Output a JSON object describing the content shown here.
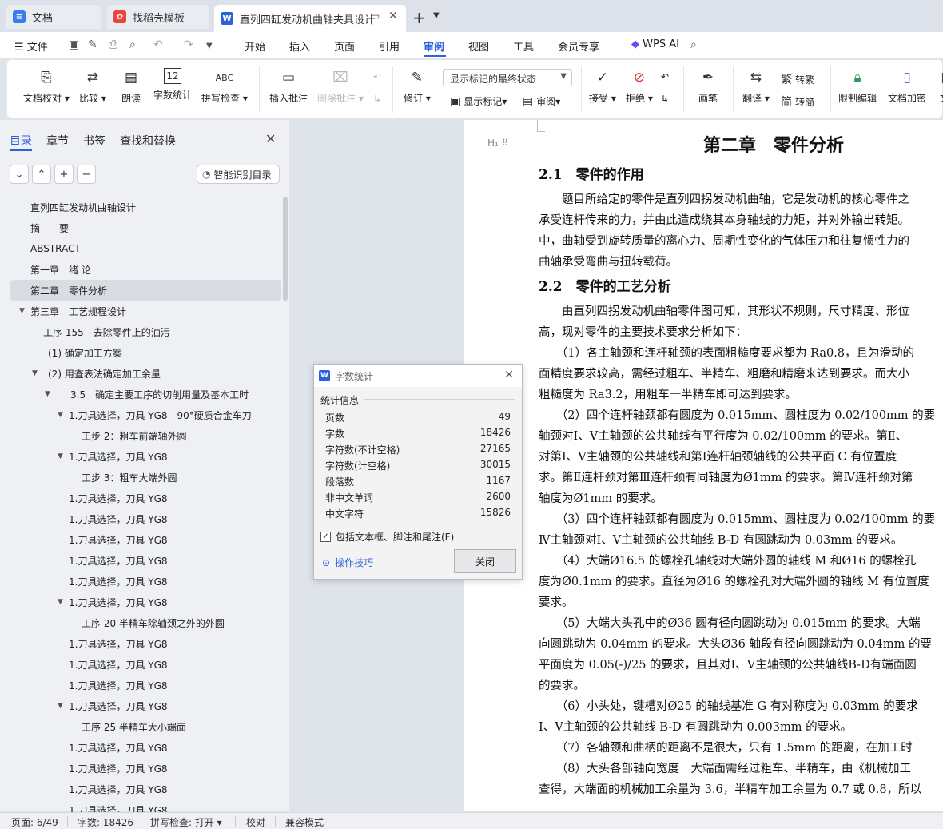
{
  "tabs": [
    {
      "icon": "document-app-icon",
      "label": "文档"
    },
    {
      "icon": "template-app-icon",
      "label": "找稻壳模板"
    },
    {
      "icon": "word-app-icon",
      "label": "直列四缸发动机曲轴夹具设计"
    }
  ],
  "menu": {
    "file": "文件",
    "items": [
      "开始",
      "插入",
      "页面",
      "引用",
      "审阅",
      "视图",
      "工具",
      "会员专享"
    ],
    "active": "审阅",
    "wps_ai": "WPS AI"
  },
  "ribbon": {
    "proofread": "文档校对",
    "compare": "比较",
    "read_aloud": "朗读",
    "word_count": "字数统计",
    "word_count_icon_text": "12",
    "spell_check": "拼写检查",
    "spell_icon_text": "ABC",
    "insert_comment": "插入批注",
    "delete_comment": "删除批注",
    "revise": "修订",
    "markup_display": "显示标记的最终状态",
    "show_markup": "显示标记",
    "review": "审阅",
    "accept": "接受",
    "reject": "拒绝",
    "pen": "画笔",
    "translate": "翻译",
    "to_traditional": "转繁",
    "to_simplified": "转简",
    "restrict_edit": "限制编辑",
    "encrypt": "文档加密",
    "cut_off": "文"
  },
  "nav": {
    "tabs": [
      "目录",
      "章节",
      "书签",
      "查找和替换"
    ],
    "smart_toc": "智能识别目录",
    "toc": [
      {
        "text": "直列四缸发动机曲轴设计",
        "indent": 0,
        "tri": ""
      },
      {
        "text": "摘　　要",
        "indent": 0,
        "tri": ""
      },
      {
        "text": "ABSTRACT",
        "indent": 0,
        "tri": ""
      },
      {
        "text": "第一章　绪 论",
        "indent": 0,
        "tri": ""
      },
      {
        "text": "第二章　零件分析",
        "indent": 0,
        "tri": "",
        "selected": true
      },
      {
        "text": "第三章　工艺规程设计",
        "indent": 0,
        "tri": "▼"
      },
      {
        "text": "工序 155　去除零件上的油污",
        "indent": 1,
        "tri": ""
      },
      {
        "text": "(1) 确定加工方案",
        "indent": 2,
        "tri": ""
      },
      {
        "text": "(2) 用查表法确定加工余量",
        "indent": 2,
        "tri": "▼"
      },
      {
        "text": "3.5　确定主要工序的切削用量及基本工时",
        "indent": 3,
        "tri": "▼"
      },
      {
        "text": "1.刀具选择，刀具 YG8　90°硬质合金车刀",
        "indent": 4,
        "tri": "▼"
      },
      {
        "text": "工步 2：粗车前端轴外圆",
        "indent": 5,
        "tri": ""
      },
      {
        "text": "1.刀具选择，刀具 YG8",
        "indent": 4,
        "tri": "▼"
      },
      {
        "text": "工步 3：粗车大端外圆",
        "indent": 5,
        "tri": ""
      },
      {
        "text": "1.刀具选择，刀具 YG8",
        "indent": 4,
        "tri": ""
      },
      {
        "text": "1.刀具选择，刀具 YG8",
        "indent": 4,
        "tri": ""
      },
      {
        "text": "1.刀具选择，刀具 YG8",
        "indent": 4,
        "tri": ""
      },
      {
        "text": "1.刀具选择，刀具 YG8",
        "indent": 4,
        "tri": ""
      },
      {
        "text": "1.刀具选择，刀具 YG8",
        "indent": 4,
        "tri": ""
      },
      {
        "text": "1.刀具选择，刀具 YG8",
        "indent": 4,
        "tri": "▼"
      },
      {
        "text": "工序 20 半精车除轴颈之外的外圆",
        "indent": 5,
        "tri": ""
      },
      {
        "text": "1.刀具选择，刀具 YG8",
        "indent": 4,
        "tri": ""
      },
      {
        "text": "1.刀具选择，刀具 YG8",
        "indent": 4,
        "tri": ""
      },
      {
        "text": "1.刀具选择，刀具 YG8",
        "indent": 4,
        "tri": ""
      },
      {
        "text": "1.刀具选择，刀具 YG8",
        "indent": 4,
        "tri": "▼"
      },
      {
        "text": "工序 25 半精车大小端面",
        "indent": 5,
        "tri": ""
      },
      {
        "text": "1.刀具选择，刀具 YG8",
        "indent": 4,
        "tri": ""
      },
      {
        "text": "1.刀具选择，刀具 YG8",
        "indent": 4,
        "tri": ""
      },
      {
        "text": "1.刀具选择，刀具 YG8",
        "indent": 4,
        "tri": ""
      },
      {
        "text": "1.刀具选择，刀具 YG8",
        "indent": 4,
        "tri": ""
      }
    ]
  },
  "document": {
    "heading_marker": "H₁",
    "title": "第二章　零件分析",
    "lines": [
      {
        "kind": "h2",
        "text": "2.1　零件的作用"
      },
      {
        "kind": "p",
        "text": "　　题目所给定的零件是直列四拐发动机曲轴，它是发动机的核心零件之"
      },
      {
        "kind": "p",
        "text": "承受连杆传来的力，并由此造成绕其本身轴线的力矩，并对外输出转矩。"
      },
      {
        "kind": "p",
        "text": "中，曲轴受到旋转质量的离心力、周期性变化的气体压力和往复惯性力的"
      },
      {
        "kind": "p",
        "text": "曲轴承受弯曲与扭转载荷。"
      },
      {
        "kind": "h2",
        "text": "2.2　零件的工艺分析"
      },
      {
        "kind": "p",
        "text": "　　由直列四拐发动机曲轴零件图可知，其形状不规则，尺寸精度、形位"
      },
      {
        "kind": "p",
        "text": "高，现对零件的主要技术要求分析如下："
      },
      {
        "kind": "p",
        "text": "　　（1）各主轴颈和连杆轴颈的表面粗糙度要求都为 Ra0.8，且为滑动的"
      },
      {
        "kind": "p",
        "text": "面精度要求较高，需经过粗车、半精车、粗磨和精磨来达到要求。而大小"
      },
      {
        "kind": "p",
        "text": "粗糙度为 Ra3.2，用粗车一半精车即可达到要求。"
      },
      {
        "kind": "p",
        "text": "　　（2）四个连杆轴颈都有圆度为 0.015mm、圆柱度为 0.02/100mm 的要"
      },
      {
        "kind": "p",
        "text": "轴颈对Ⅰ、Ⅴ主轴颈的公共轴线有平行度为 0.02/100mm 的要求。第Ⅱ、"
      },
      {
        "kind": "p",
        "text": "对第Ⅰ、Ⅴ主轴颈的公共轴线和第Ⅰ连杆轴颈轴线的公共平面 C 有位置度"
      },
      {
        "kind": "p",
        "text": "求。第Ⅱ连杆颈对第Ⅲ连杆颈有同轴度为Ø1mm 的要求。第Ⅳ连杆颈对第"
      },
      {
        "kind": "p",
        "text": "轴度为Ø1mm 的要求。"
      },
      {
        "kind": "p",
        "text": "　　（3）四个连杆轴颈都有圆度为 0.015mm、圆柱度为 0.02/100mm 的要"
      },
      {
        "kind": "p",
        "text": "Ⅳ主轴颈对Ⅰ、Ⅴ主轴颈的公共轴线 B-D 有圆跳动为 0.03mm 的要求。"
      },
      {
        "kind": "p",
        "text": "　　（4）大端Ø16.5 的螺栓孔轴线对大端外圆的轴线 M 和Ø16 的螺栓孔"
      },
      {
        "kind": "p",
        "text": "度为Ø0.1mm 的要求。直径为Ø16 的螺栓孔对大端外圆的轴线 M 有位置度"
      },
      {
        "kind": "p",
        "text": "要求。"
      },
      {
        "kind": "p",
        "text": "　　（5）大端大头孔中的Ø36 圆有径向圆跳动为 0.015mm 的要求。大端"
      },
      {
        "kind": "p",
        "text": "向圆跳动为 0.04mm 的要求。大头Ø36 轴段有径向圆跳动为 0.04mm 的要"
      },
      {
        "kind": "p",
        "text": "平面度为 0.05(-)/25 的要求，且其对Ⅰ、Ⅴ主轴颈的公共轴线B-D有端面圆"
      },
      {
        "kind": "p",
        "text": "的要求。"
      },
      {
        "kind": "p",
        "text": "　　（6）小头处，键槽对Ø25 的轴线基准 G 有对称度为 0.03mm 的要求"
      },
      {
        "kind": "p",
        "text": "Ⅰ、Ⅴ主轴颈的公共轴线 B-D 有圆跳动为 0.003mm 的要求。"
      },
      {
        "kind": "p",
        "text": "　　（7）各轴颈和曲柄的距离不是很大，只有 1.5mm 的距离，在加工时"
      },
      {
        "kind": "p",
        "text": "　　（8）大头各部轴向宽度　大端面需经过粗车、半精车，由《机械加工"
      },
      {
        "kind": "p",
        "text": "查得，大端面的机械加工余量为 3.6，半精车加工余量为 0.7 或 0.8，所以"
      }
    ]
  },
  "dialog": {
    "title": "字数统计",
    "section": "统计信息",
    "stats": [
      {
        "label": "页数",
        "value": "49"
      },
      {
        "label": "字数",
        "value": "18426"
      },
      {
        "label": "字符数(不计空格)",
        "value": "27165"
      },
      {
        "label": "字符数(计空格)",
        "value": "30015"
      },
      {
        "label": "段落数",
        "value": "1167"
      },
      {
        "label": "非中文单词",
        "value": "2600"
      },
      {
        "label": "中文字符",
        "value": "15826"
      }
    ],
    "include_label": "包括文本框、脚注和尾注(F)",
    "include_checked": true,
    "tips": "操作技巧",
    "close": "关闭"
  },
  "status": {
    "page": "页面: 6/49",
    "words": "字数: 18426",
    "spell": "拼写检查: 打开",
    "proof": "校对",
    "compat": "兼容模式"
  },
  "colors": {
    "accent": "#2c62d8",
    "word_blue": "#2c62d8",
    "template_red": "#e8463f",
    "doc_icon_blue": "#3a7bf0"
  }
}
